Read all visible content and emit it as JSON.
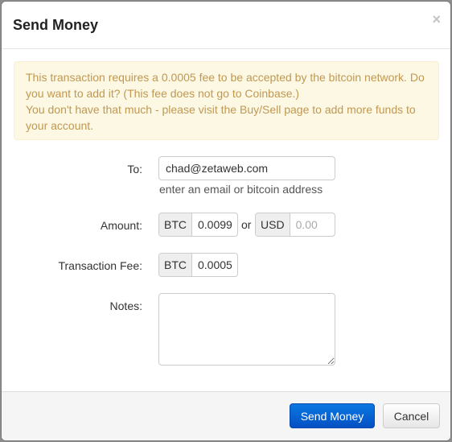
{
  "modal": {
    "title": "Send Money",
    "close_icon": "×"
  },
  "alert": {
    "line1": "This transaction requires a 0.0005 fee to be accepted by the bitcoin network. Do you want to add it? (This fee does not go to Coinbase.)",
    "line2": "You don't have that much - please visit the Buy/Sell page to add more funds to your account."
  },
  "form": {
    "to": {
      "label": "To:",
      "value": "chad@zetaweb.com",
      "help": "enter an email or bitcoin address"
    },
    "amount": {
      "label": "Amount:",
      "btc_addon": "BTC",
      "btc_value": "0.0099",
      "or_text": "or",
      "usd_addon": "USD",
      "usd_placeholder": "0.00"
    },
    "fee": {
      "label": "Transaction Fee:",
      "btc_addon": "BTC",
      "value": "0.0005"
    },
    "notes": {
      "label": "Notes:",
      "value": ""
    }
  },
  "footer": {
    "send_label": "Send Money",
    "cancel_label": "Cancel"
  }
}
